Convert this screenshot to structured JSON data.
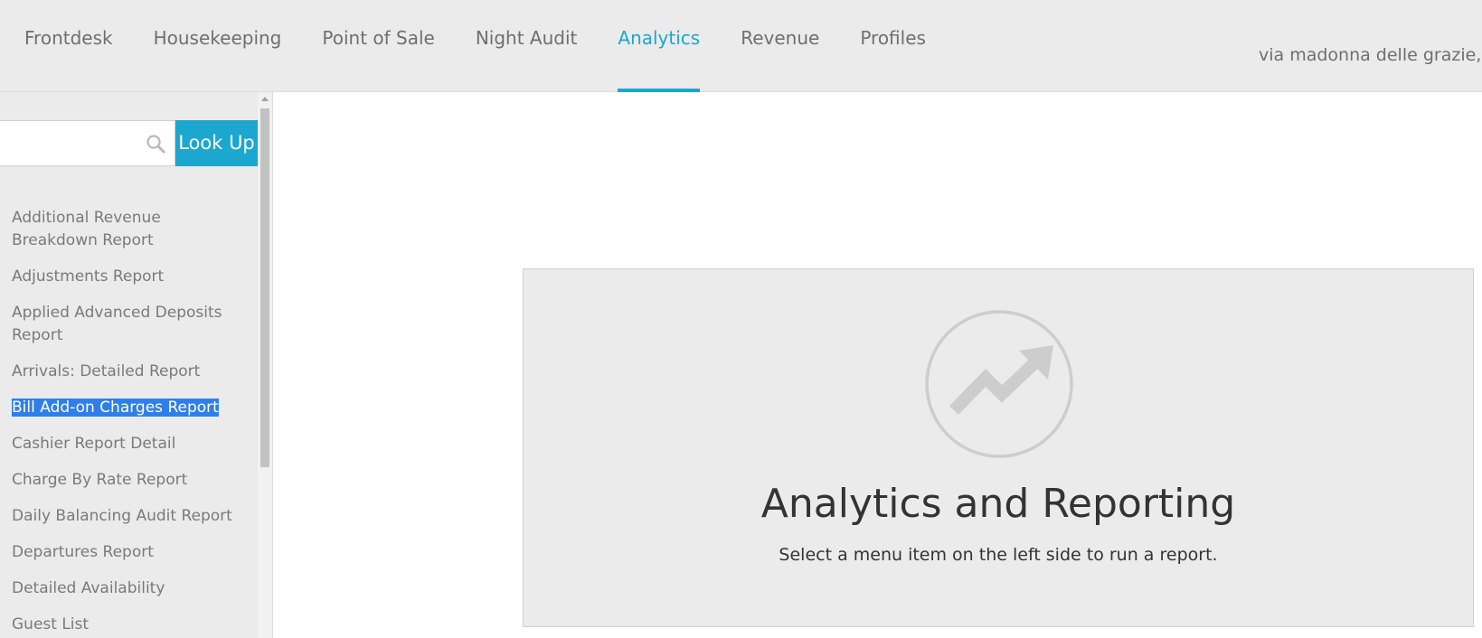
{
  "nav": {
    "tabs": [
      {
        "label": "Frontdesk"
      },
      {
        "label": "Housekeeping"
      },
      {
        "label": "Point of Sale"
      },
      {
        "label": "Night Audit"
      },
      {
        "label": "Analytics"
      },
      {
        "label": "Revenue"
      },
      {
        "label": "Profiles"
      }
    ],
    "active_tab": "Analytics",
    "property_text": "via madonna delle grazie,"
  },
  "search": {
    "value": "",
    "placeholder": "",
    "icon": "search-icon",
    "button_label": "Look Up"
  },
  "sidebar": {
    "items": [
      {
        "label": "Additional Revenue Breakdown Report"
      },
      {
        "label": "Adjustments Report"
      },
      {
        "label": "Applied Advanced Deposits Report"
      },
      {
        "label": "Arrivals: Detailed Report"
      },
      {
        "label": "Bill Add-on Charges Report",
        "selected": true
      },
      {
        "label": "Cashier Report Detail"
      },
      {
        "label": "Charge By Rate Report"
      },
      {
        "label": "Daily Balancing Audit Report"
      },
      {
        "label": "Departures Report"
      },
      {
        "label": "Detailed Availability"
      },
      {
        "label": "Guest List"
      }
    ]
  },
  "main": {
    "icon": "trending-up-icon",
    "title": "Analytics and Reporting",
    "subtitle": "Select a menu item on the left side to run a report."
  },
  "colors": {
    "accent": "#1ba7cf",
    "selection": "#2f7fe8",
    "background_gray": "#ebebeb"
  }
}
